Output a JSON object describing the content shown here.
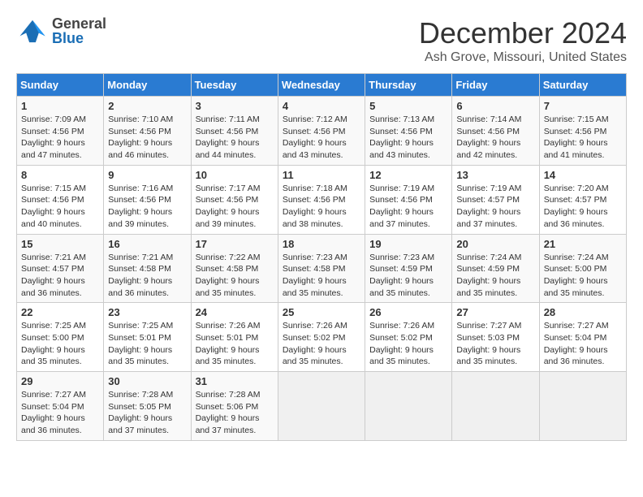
{
  "header": {
    "logo_general": "General",
    "logo_blue": "Blue",
    "title": "December 2024",
    "subtitle": "Ash Grove, Missouri, United States"
  },
  "calendar": {
    "days_of_week": [
      "Sunday",
      "Monday",
      "Tuesday",
      "Wednesday",
      "Thursday",
      "Friday",
      "Saturday"
    ],
    "weeks": [
      [
        {
          "num": "",
          "empty": true
        },
        {
          "num": "",
          "empty": true
        },
        {
          "num": "",
          "empty": true
        },
        {
          "num": "",
          "empty": true
        },
        {
          "num": "",
          "empty": true
        },
        {
          "num": "",
          "empty": true
        },
        {
          "num": "",
          "empty": true
        }
      ],
      [
        {
          "num": "1",
          "sunrise": "Sunrise: 7:09 AM",
          "sunset": "Sunset: 4:56 PM",
          "daylight": "Daylight: 9 hours and 47 minutes."
        },
        {
          "num": "2",
          "sunrise": "Sunrise: 7:10 AM",
          "sunset": "Sunset: 4:56 PM",
          "daylight": "Daylight: 9 hours and 46 minutes."
        },
        {
          "num": "3",
          "sunrise": "Sunrise: 7:11 AM",
          "sunset": "Sunset: 4:56 PM",
          "daylight": "Daylight: 9 hours and 44 minutes."
        },
        {
          "num": "4",
          "sunrise": "Sunrise: 7:12 AM",
          "sunset": "Sunset: 4:56 PM",
          "daylight": "Daylight: 9 hours and 43 minutes."
        },
        {
          "num": "5",
          "sunrise": "Sunrise: 7:13 AM",
          "sunset": "Sunset: 4:56 PM",
          "daylight": "Daylight: 9 hours and 43 minutes."
        },
        {
          "num": "6",
          "sunrise": "Sunrise: 7:14 AM",
          "sunset": "Sunset: 4:56 PM",
          "daylight": "Daylight: 9 hours and 42 minutes."
        },
        {
          "num": "7",
          "sunrise": "Sunrise: 7:15 AM",
          "sunset": "Sunset: 4:56 PM",
          "daylight": "Daylight: 9 hours and 41 minutes."
        }
      ],
      [
        {
          "num": "8",
          "sunrise": "Sunrise: 7:15 AM",
          "sunset": "Sunset: 4:56 PM",
          "daylight": "Daylight: 9 hours and 40 minutes."
        },
        {
          "num": "9",
          "sunrise": "Sunrise: 7:16 AM",
          "sunset": "Sunset: 4:56 PM",
          "daylight": "Daylight: 9 hours and 39 minutes."
        },
        {
          "num": "10",
          "sunrise": "Sunrise: 7:17 AM",
          "sunset": "Sunset: 4:56 PM",
          "daylight": "Daylight: 9 hours and 39 minutes."
        },
        {
          "num": "11",
          "sunrise": "Sunrise: 7:18 AM",
          "sunset": "Sunset: 4:56 PM",
          "daylight": "Daylight: 9 hours and 38 minutes."
        },
        {
          "num": "12",
          "sunrise": "Sunrise: 7:19 AM",
          "sunset": "Sunset: 4:56 PM",
          "daylight": "Daylight: 9 hours and 37 minutes."
        },
        {
          "num": "13",
          "sunrise": "Sunrise: 7:19 AM",
          "sunset": "Sunset: 4:57 PM",
          "daylight": "Daylight: 9 hours and 37 minutes."
        },
        {
          "num": "14",
          "sunrise": "Sunrise: 7:20 AM",
          "sunset": "Sunset: 4:57 PM",
          "daylight": "Daylight: 9 hours and 36 minutes."
        }
      ],
      [
        {
          "num": "15",
          "sunrise": "Sunrise: 7:21 AM",
          "sunset": "Sunset: 4:57 PM",
          "daylight": "Daylight: 9 hours and 36 minutes."
        },
        {
          "num": "16",
          "sunrise": "Sunrise: 7:21 AM",
          "sunset": "Sunset: 4:58 PM",
          "daylight": "Daylight: 9 hours and 36 minutes."
        },
        {
          "num": "17",
          "sunrise": "Sunrise: 7:22 AM",
          "sunset": "Sunset: 4:58 PM",
          "daylight": "Daylight: 9 hours and 35 minutes."
        },
        {
          "num": "18",
          "sunrise": "Sunrise: 7:23 AM",
          "sunset": "Sunset: 4:58 PM",
          "daylight": "Daylight: 9 hours and 35 minutes."
        },
        {
          "num": "19",
          "sunrise": "Sunrise: 7:23 AM",
          "sunset": "Sunset: 4:59 PM",
          "daylight": "Daylight: 9 hours and 35 minutes."
        },
        {
          "num": "20",
          "sunrise": "Sunrise: 7:24 AM",
          "sunset": "Sunset: 4:59 PM",
          "daylight": "Daylight: 9 hours and 35 minutes."
        },
        {
          "num": "21",
          "sunrise": "Sunrise: 7:24 AM",
          "sunset": "Sunset: 5:00 PM",
          "daylight": "Daylight: 9 hours and 35 minutes."
        }
      ],
      [
        {
          "num": "22",
          "sunrise": "Sunrise: 7:25 AM",
          "sunset": "Sunset: 5:00 PM",
          "daylight": "Daylight: 9 hours and 35 minutes."
        },
        {
          "num": "23",
          "sunrise": "Sunrise: 7:25 AM",
          "sunset": "Sunset: 5:01 PM",
          "daylight": "Daylight: 9 hours and 35 minutes."
        },
        {
          "num": "24",
          "sunrise": "Sunrise: 7:26 AM",
          "sunset": "Sunset: 5:01 PM",
          "daylight": "Daylight: 9 hours and 35 minutes."
        },
        {
          "num": "25",
          "sunrise": "Sunrise: 7:26 AM",
          "sunset": "Sunset: 5:02 PM",
          "daylight": "Daylight: 9 hours and 35 minutes."
        },
        {
          "num": "26",
          "sunrise": "Sunrise: 7:26 AM",
          "sunset": "Sunset: 5:02 PM",
          "daylight": "Daylight: 9 hours and 35 minutes."
        },
        {
          "num": "27",
          "sunrise": "Sunrise: 7:27 AM",
          "sunset": "Sunset: 5:03 PM",
          "daylight": "Daylight: 9 hours and 35 minutes."
        },
        {
          "num": "28",
          "sunrise": "Sunrise: 7:27 AM",
          "sunset": "Sunset: 5:04 PM",
          "daylight": "Daylight: 9 hours and 36 minutes."
        }
      ],
      [
        {
          "num": "29",
          "sunrise": "Sunrise: 7:27 AM",
          "sunset": "Sunset: 5:04 PM",
          "daylight": "Daylight: 9 hours and 36 minutes."
        },
        {
          "num": "30",
          "sunrise": "Sunrise: 7:28 AM",
          "sunset": "Sunset: 5:05 PM",
          "daylight": "Daylight: 9 hours and 37 minutes."
        },
        {
          "num": "31",
          "sunrise": "Sunrise: 7:28 AM",
          "sunset": "Sunset: 5:06 PM",
          "daylight": "Daylight: 9 hours and 37 minutes."
        },
        {
          "num": "",
          "empty": true
        },
        {
          "num": "",
          "empty": true
        },
        {
          "num": "",
          "empty": true
        },
        {
          "num": "",
          "empty": true
        }
      ]
    ]
  }
}
